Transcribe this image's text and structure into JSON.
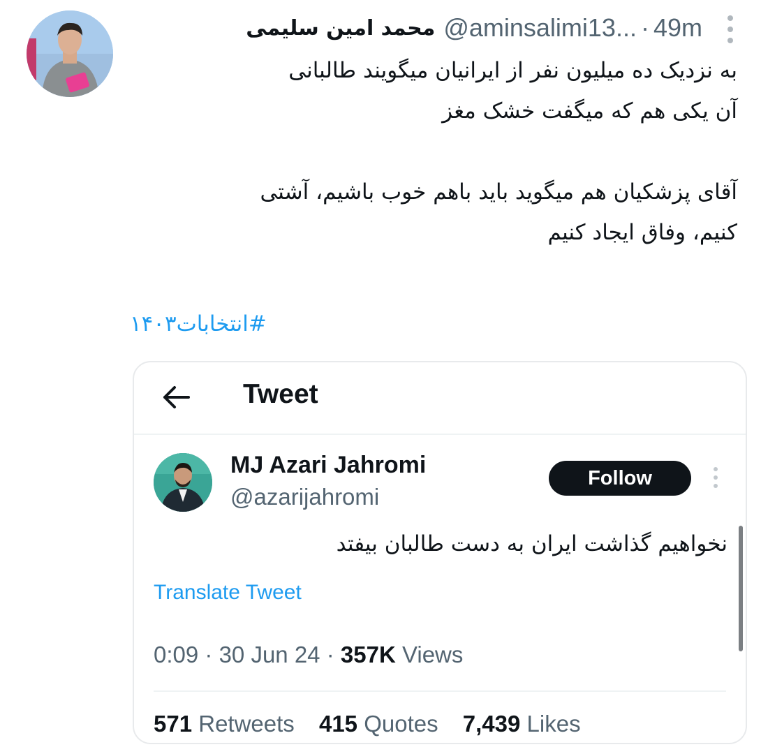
{
  "outer_tweet": {
    "author_name": "محمد امین سلیمی",
    "handle": "@aminsalimi13...",
    "separator": "·",
    "time_ago": "49m",
    "paragraph1": [
      "به نزدیک ده میلیون نفر از ایرانیان میگویند طالبانی",
      "آن یکی هم که میگفت خشک مغز"
    ],
    "paragraph2": [
      "آقای پزشکیان هم میگوید باید باهم خوب باشیم، آشتی",
      "کنیم، وفاق ایجاد کنیم"
    ],
    "hashtag": "#انتخابات۱۴۰۳"
  },
  "quoted_card": {
    "title": "Tweet",
    "author_name": "MJ Azari Jahromi",
    "handle": "@azarijahromi",
    "follow_label": "Follow",
    "text": "نخواهیم گذاشت ایران به دست طالبان بیفتد",
    "translate_label": "Translate Tweet",
    "time": "0:09",
    "meta_sep": "·",
    "date": "30 Jun 24",
    "views_count": "357K",
    "views_label": "Views",
    "retweets_count": "571",
    "retweets_label": "Retweets",
    "quotes_count": "415",
    "quotes_label": "Quotes",
    "likes_count": "7,439",
    "likes_label": "Likes"
  },
  "icons": {
    "back": "arrow-left-icon",
    "more_outer": "more-vertical-icon",
    "more_inner": "more-vertical-icon"
  },
  "colors": {
    "link_blue": "#1d9bf0",
    "muted_gray": "#536471",
    "text_dark": "#0f1419",
    "follow_bg": "#0f1419"
  }
}
